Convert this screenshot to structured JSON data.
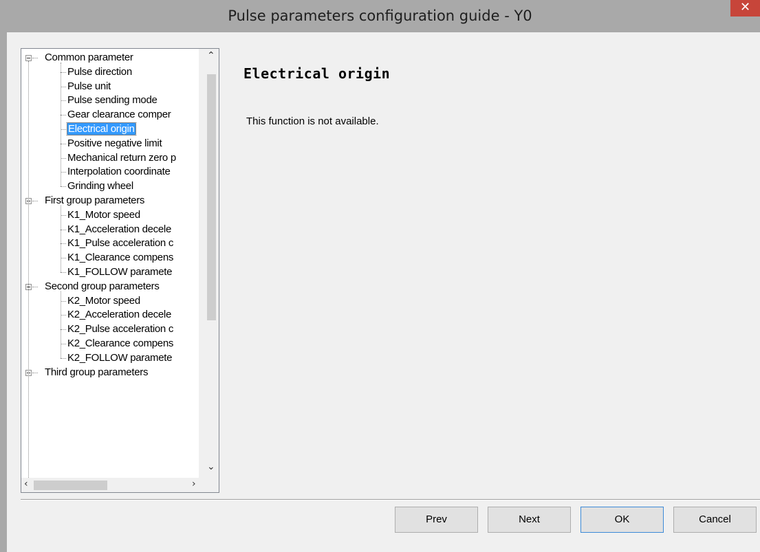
{
  "window": {
    "title": "Pulse parameters configuration guide - Y0",
    "close_glyph": "✕"
  },
  "tree": {
    "groups": [
      {
        "label": "Common parameter",
        "items": [
          "Pulse direction",
          "Pulse unit",
          "Pulse sending mode",
          "Gear clearance comper",
          "Electrical origin",
          "Positive negative limit",
          "Mechanical return zero p",
          "Interpolation coordinate",
          "Grinding wheel"
        ]
      },
      {
        "label": "First group parameters",
        "items": [
          "K1_Motor speed",
          "K1_Acceleration decele",
          "K1_Pulse acceleration c",
          "K1_Clearance compens",
          "K1_FOLLOW paramete"
        ]
      },
      {
        "label": "Second group parameters",
        "items": [
          "K2_Motor speed",
          "K2_Acceleration decele",
          "K2_Pulse acceleration c",
          "K2_Clearance compens",
          "K2_FOLLOW paramete"
        ]
      },
      {
        "label": "Third group parameters",
        "items": []
      }
    ],
    "selected": "Electrical origin"
  },
  "content": {
    "heading": "Electrical origin",
    "message": "This function is not available."
  },
  "buttons": {
    "prev": "Prev",
    "next": "Next",
    "ok": "OK",
    "cancel": "Cancel"
  },
  "colors": {
    "selection": "#3399ff",
    "default_button_border": "#3c8ad7",
    "close_button": "#c7453a"
  }
}
